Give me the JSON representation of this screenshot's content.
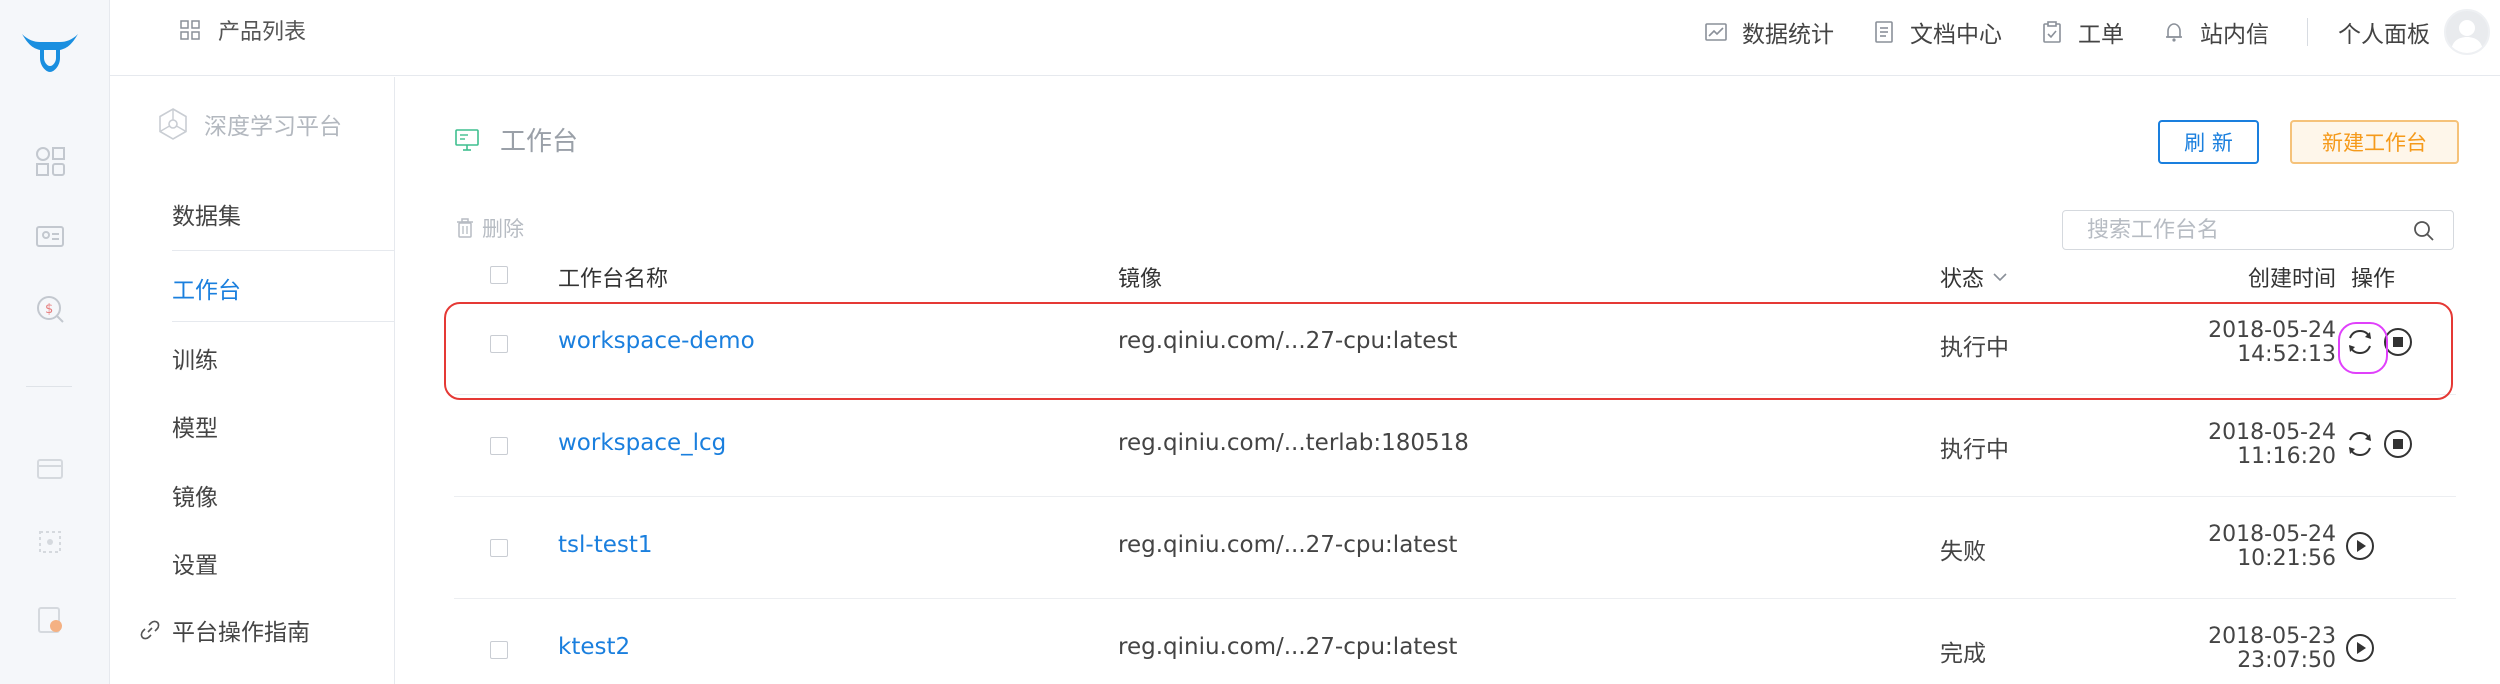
{
  "topbar": {
    "product_list": "产品列表",
    "nav": [
      {
        "label": "数据统计",
        "icon": "chart-icon"
      },
      {
        "label": "文档中心",
        "icon": "document-icon"
      },
      {
        "label": "工单",
        "icon": "clipboard-icon"
      },
      {
        "label": "站内信",
        "icon": "bell-icon"
      }
    ],
    "personal_panel": "个人面板"
  },
  "sidebar": {
    "platform": "深度学习平台",
    "items": [
      {
        "label": "数据集"
      },
      {
        "label": "工作台",
        "active": true
      },
      {
        "label": "训练"
      },
      {
        "label": "模型"
      },
      {
        "label": "镜像"
      },
      {
        "label": "设置"
      }
    ],
    "guide": "平台操作指南"
  },
  "main": {
    "title": "工作台",
    "refresh": "刷 新",
    "new_workspace": "新建工作台",
    "delete": "删除",
    "search_placeholder": "搜索工作台名",
    "columns": {
      "name": "工作台名称",
      "image": "镜像",
      "status": "状态",
      "created": "创建时间",
      "actions": "操作"
    },
    "rows": [
      {
        "name": "workspace-demo",
        "image": "reg.qiniu.com/...27-cpu:latest",
        "status": "执行中",
        "date": "2018-05-24",
        "time": "14:52:13",
        "actions": [
          "restart-icon",
          "stop-icon"
        ]
      },
      {
        "name": "workspace_lcg",
        "image": "reg.qiniu.com/...terlab:180518",
        "status": "执行中",
        "date": "2018-05-24",
        "time": "11:16:20",
        "actions": [
          "restart-icon",
          "stop-icon"
        ]
      },
      {
        "name": "tsl-test1",
        "image": "reg.qiniu.com/...27-cpu:latest",
        "status": "失败",
        "date": "2018-05-24",
        "time": "10:21:56",
        "actions": [
          "play-icon"
        ]
      },
      {
        "name": "ktest2",
        "image": "reg.qiniu.com/...27-cpu:latest",
        "status": "完成",
        "date": "2018-05-23",
        "time": "23:07:50",
        "actions": [
          "play-icon"
        ]
      }
    ]
  },
  "colors": {
    "accent": "#1a7fde",
    "warning": "#f59a1b",
    "highlight_red": "#e53935",
    "highlight_pink": "#e040fb"
  }
}
